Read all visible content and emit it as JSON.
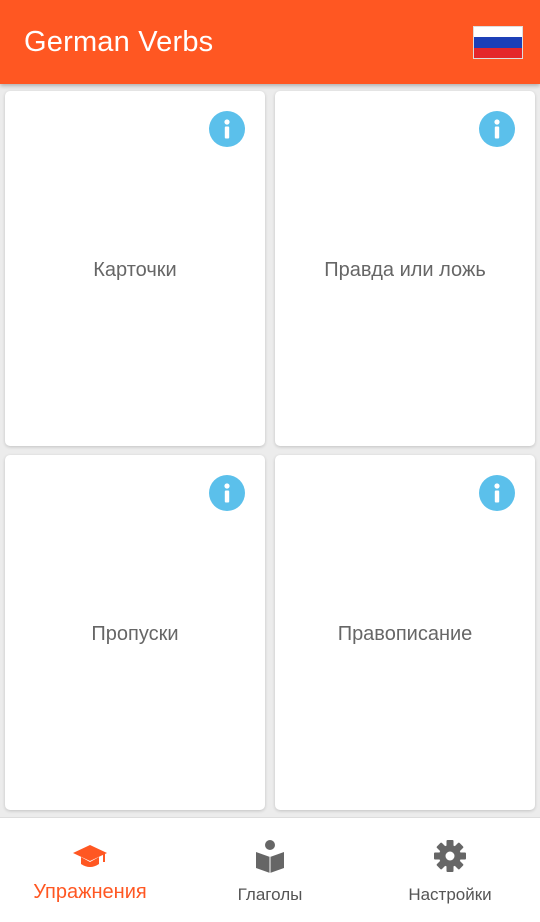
{
  "colors": {
    "primary": "#ff5722",
    "info": "#5bc0eb",
    "text_muted": "#666666",
    "nav_inactive": "#555555"
  },
  "appbar": {
    "title": "German Verbs",
    "language_flag_icon": "russian-flag-icon"
  },
  "cards": [
    {
      "label": "Карточки",
      "info_icon": "info-icon"
    },
    {
      "label": "Правда или ложь",
      "info_icon": "info-icon"
    },
    {
      "label": "Пропуски",
      "info_icon": "info-icon"
    },
    {
      "label": "Правописание",
      "info_icon": "info-icon"
    }
  ],
  "bottom_nav": {
    "items": [
      {
        "label": "Упражнения",
        "icon": "graduation-cap-icon",
        "active": true
      },
      {
        "label": "Глаголы",
        "icon": "book-reader-icon",
        "active": false
      },
      {
        "label": "Настройки",
        "icon": "gear-icon",
        "active": false
      }
    ]
  }
}
